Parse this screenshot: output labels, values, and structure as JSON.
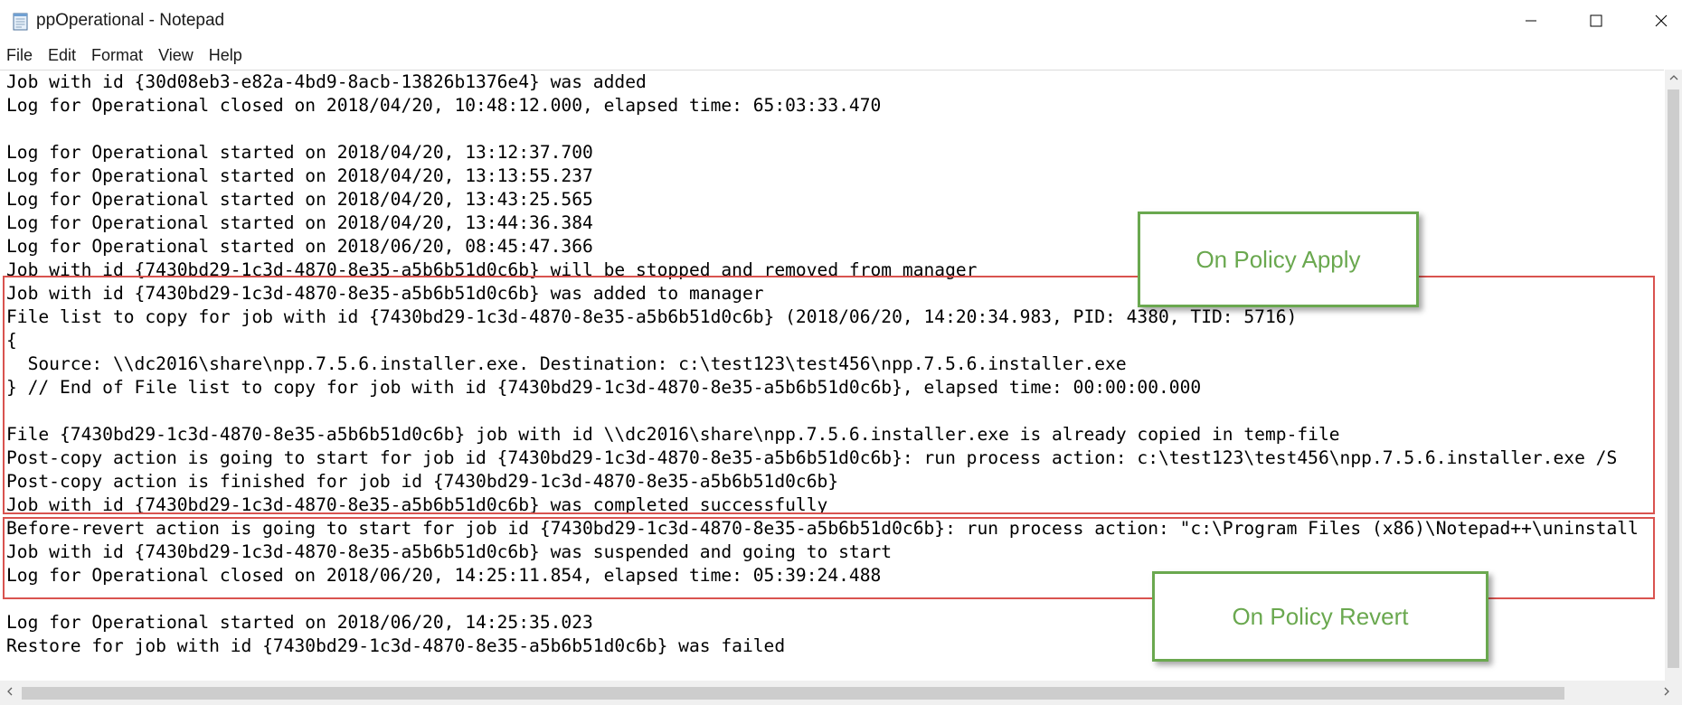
{
  "window": {
    "title": "ppOperational - Notepad"
  },
  "menu": [
    "File",
    "Edit",
    "Format",
    "View",
    "Help"
  ],
  "editor": {
    "lines": [
      "Job with id {30d08eb3-e82a-4bd9-8acb-13826b1376e4} was added",
      "Log for Operational closed on 2018/04/20, 10:48:12.000, elapsed time: 65:03:33.470",
      "",
      "Log for Operational started on 2018/04/20, 13:12:37.700",
      "Log for Operational started on 2018/04/20, 13:13:55.237",
      "Log for Operational started on 2018/04/20, 13:43:25.565",
      "Log for Operational started on 2018/04/20, 13:44:36.384",
      "Log for Operational started on 2018/06/20, 08:45:47.366",
      "Job with id {7430bd29-1c3d-4870-8e35-a5b6b51d0c6b} will be stopped and removed from manager",
      "Job with id {7430bd29-1c3d-4870-8e35-a5b6b51d0c6b} was added to manager",
      "File list to copy for job with id {7430bd29-1c3d-4870-8e35-a5b6b51d0c6b} (2018/06/20, 14:20:34.983, PID: 4380, TID: 5716)",
      "{",
      "  Source: \\\\dc2016\\share\\npp.7.5.6.installer.exe. Destination: c:\\test123\\test456\\npp.7.5.6.installer.exe",
      "} // End of File list to copy for job with id {7430bd29-1c3d-4870-8e35-a5b6b51d0c6b}, elapsed time: 00:00:00.000",
      "",
      "File {7430bd29-1c3d-4870-8e35-a5b6b51d0c6b} job with id \\\\dc2016\\share\\npp.7.5.6.installer.exe is already copied in temp-file",
      "Post-copy action is going to start for job id {7430bd29-1c3d-4870-8e35-a5b6b51d0c6b}: run process action: c:\\test123\\test456\\npp.7.5.6.installer.exe /S",
      "Post-copy action is finished for job id {7430bd29-1c3d-4870-8e35-a5b6b51d0c6b}",
      "Job with id {7430bd29-1c3d-4870-8e35-a5b6b51d0c6b} was completed successfully",
      "Before-revert action is going to start for job id {7430bd29-1c3d-4870-8e35-a5b6b51d0c6b}: run process action: \"c:\\Program Files (x86)\\Notepad++\\uninstall",
      "Job with id {7430bd29-1c3d-4870-8e35-a5b6b51d0c6b} was suspended and going to start",
      "Log for Operational closed on 2018/06/20, 14:25:11.854, elapsed time: 05:39:24.488",
      "",
      "Log for Operational started on 2018/06/20, 14:25:35.023",
      "Restore for job with id {7430bd29-1c3d-4870-8e35-a5b6b51d0c6b} was failed"
    ]
  },
  "annotations": {
    "apply_label": "On Policy Apply",
    "revert_label": "On Policy Revert",
    "box_color": "#d9534f",
    "callout_color": "#6aa84f"
  }
}
